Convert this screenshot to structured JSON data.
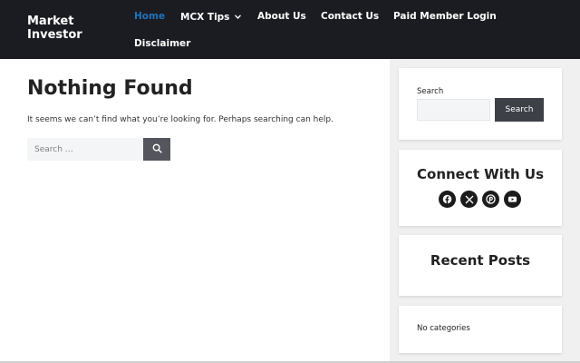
{
  "site": {
    "title": "Market Investor"
  },
  "nav": {
    "items": [
      {
        "label": "Home",
        "active": true
      },
      {
        "label": "MCX Tips",
        "has_dropdown": true
      },
      {
        "label": "About Us"
      },
      {
        "label": "Contact Us"
      },
      {
        "label": "Paid Member Login"
      },
      {
        "label": "Disclaimer"
      }
    ]
  },
  "main": {
    "title": "Nothing Found",
    "message": "It seems we can’t find what you’re looking for. Perhaps searching can help.",
    "search": {
      "placeholder": "Search …"
    }
  },
  "sidebar": {
    "search": {
      "label": "Search",
      "button": "Search"
    },
    "connect": {
      "title": "Connect With Us",
      "icons": [
        "facebook-icon",
        "x-icon",
        "pinterest-icon",
        "youtube-icon"
      ]
    },
    "recent_posts": {
      "title": "Recent Posts"
    },
    "categories": {
      "text": "No categories"
    }
  },
  "colors": {
    "header_bg": "#1b1c21",
    "accent": "#1e73be",
    "button_bg": "#3e4048"
  }
}
